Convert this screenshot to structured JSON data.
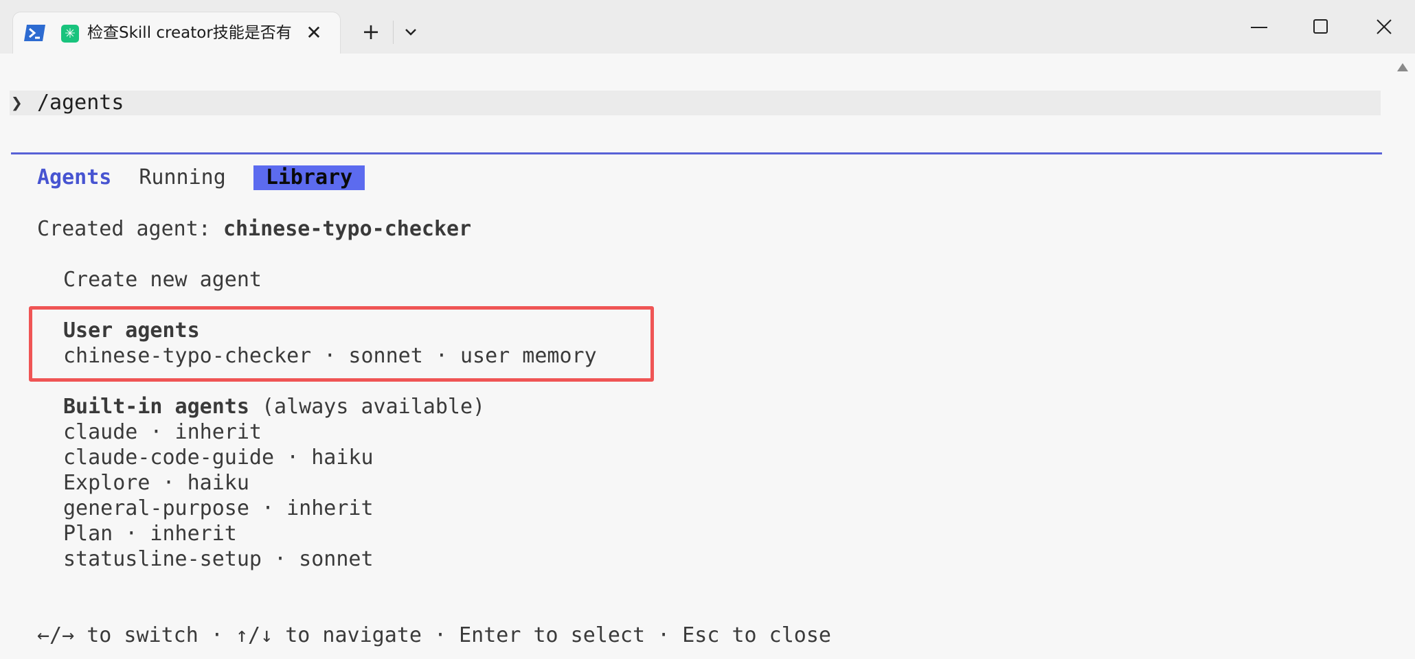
{
  "window": {
    "tab_title": "检查Skill creator技能是否有",
    "new_tab_symbol": "+",
    "close_tab_symbol": "✕"
  },
  "terminal": {
    "prompt_glyph": "❯",
    "command": "/agents",
    "tabs": [
      {
        "label": "Agents",
        "state": "accent"
      },
      {
        "label": "Running",
        "state": "normal"
      },
      {
        "label": "Library",
        "state": "selected"
      }
    ],
    "created_prefix": "Created agent: ",
    "created_name": "chinese-typo-checker",
    "create_new": "Create new agent",
    "user_agents_header": "User agents",
    "user_agents": [
      "chinese-typo-checker · sonnet · user memory"
    ],
    "builtin_header": "Built-in agents",
    "builtin_note": " (always available)",
    "builtin_agents": [
      "claude · inherit",
      "claude-code-guide · haiku",
      "Explore · haiku",
      "general-purpose · inherit",
      "Plan · inherit",
      "statusline-setup · sonnet"
    ],
    "footer_hint": "←/→ to switch · ↑/↓ to navigate · Enter to select · Esc to close"
  },
  "colors": {
    "accent": "#4754d1",
    "selected_tab_bg": "#5c6bef",
    "highlight_border": "#ef5555",
    "divider": "#5861d6"
  }
}
